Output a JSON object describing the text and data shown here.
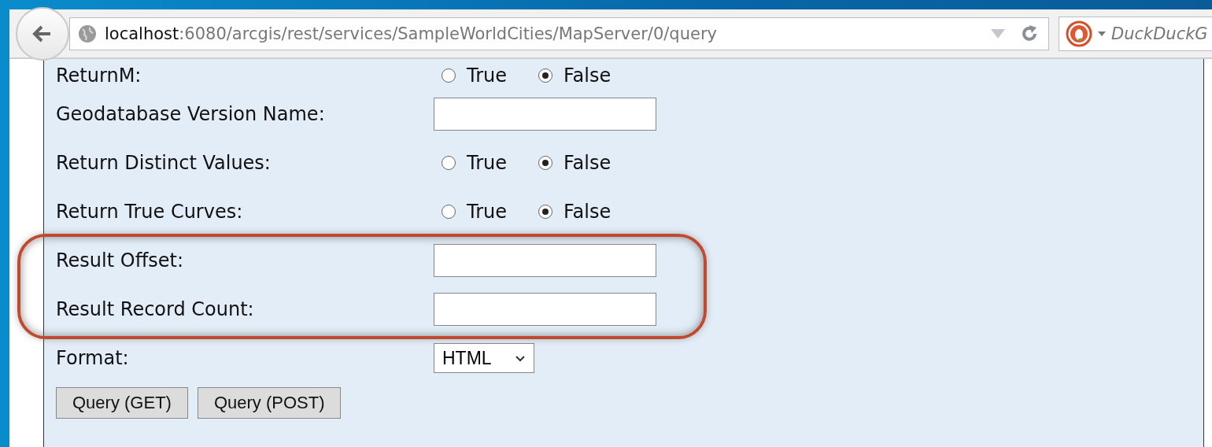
{
  "browser": {
    "url_host": "localhost",
    "url_path": ":6080/arcgis/rest/services/SampleWorldCities/MapServer/0/query",
    "search_placeholder": "DuckDuckG"
  },
  "form": {
    "rows": [
      {
        "kind": "radio",
        "label": "ReturnM:",
        "options": [
          {
            "label": "True",
            "selected": false
          },
          {
            "label": "False",
            "selected": true
          }
        ]
      },
      {
        "kind": "text",
        "label": "Geodatabase Version Name:"
      },
      {
        "kind": "radio",
        "label": "Return Distinct Values:",
        "options": [
          {
            "label": "True",
            "selected": false
          },
          {
            "label": "False",
            "selected": true
          }
        ]
      },
      {
        "kind": "radio",
        "label": "Return True Curves:",
        "options": [
          {
            "label": "True",
            "selected": false
          },
          {
            "label": "False",
            "selected": true
          }
        ]
      },
      {
        "kind": "text",
        "label": "Result Offset:",
        "highlighted": true
      },
      {
        "kind": "text",
        "label": "Result Record Count:",
        "highlighted": true
      },
      {
        "kind": "select",
        "label": "Format:",
        "value": "HTML"
      }
    ],
    "buttons": [
      "Query (GET)",
      "Query (POST)"
    ]
  }
}
